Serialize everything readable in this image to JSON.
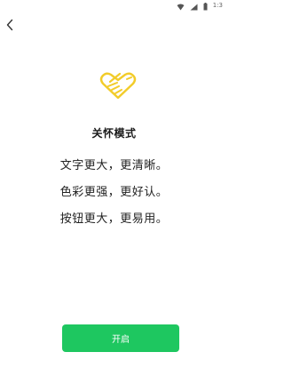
{
  "status_bar": {
    "time": "1:3",
    "icons": [
      "wifi-icon",
      "signal-icon",
      "battery-icon"
    ]
  },
  "nav": {
    "back_icon": "chevron-left-icon"
  },
  "hero": {
    "icon": "handshake-icon",
    "color": "#f2cc2a"
  },
  "page": {
    "title": "关怀模式",
    "features": [
      "文字更大，更清晰。",
      "色彩更强，更好认。",
      "按钮更大，更易用。"
    ]
  },
  "actions": {
    "enable_label": "开启",
    "accent_color": "#1ec760"
  }
}
